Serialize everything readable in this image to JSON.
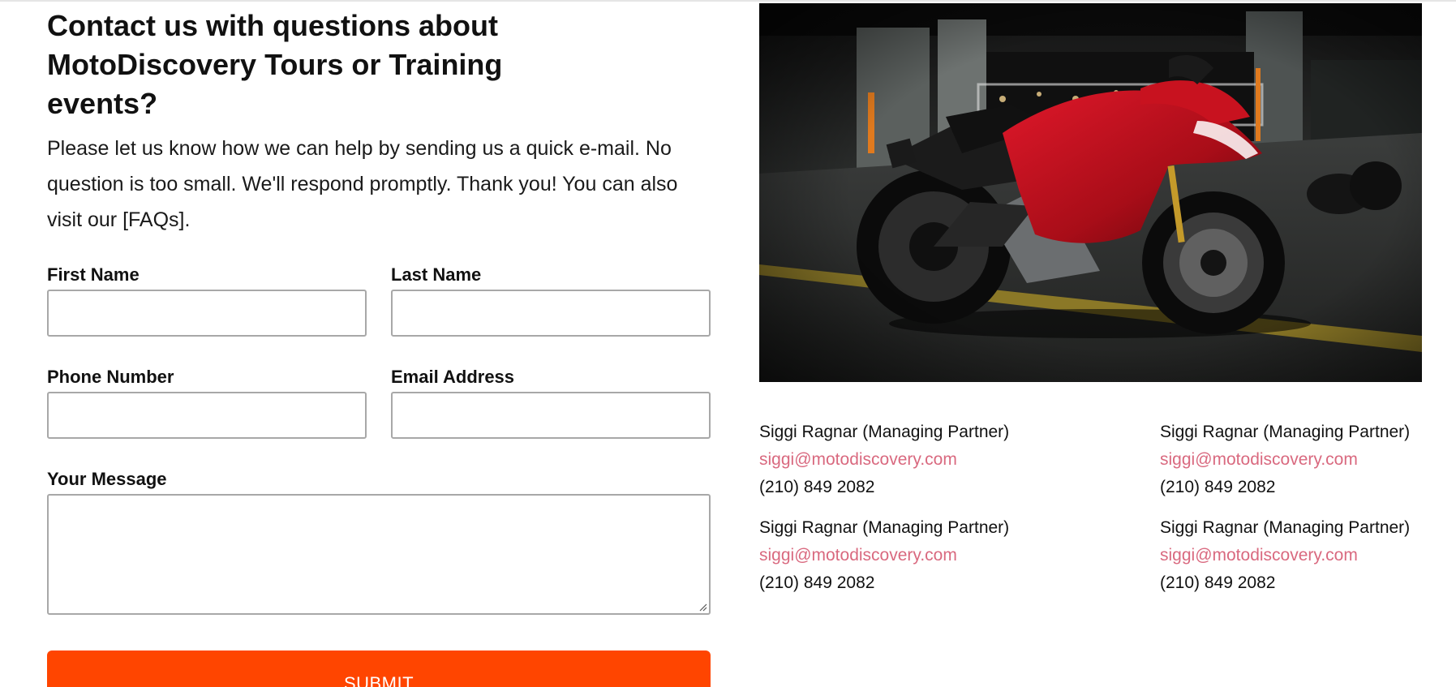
{
  "page": {
    "heading": "Contact us with questions about MotoDiscovery Tours or Training events?",
    "intro": "Please let us know how we can help by sending us a quick e-mail. No question is too small. We'll respond promptly. Thank you! You can also visit our [FAQs]."
  },
  "form": {
    "first_name_label": "First Name",
    "last_name_label": "Last Name",
    "phone_label": "Phone Number",
    "email_label": "Email Address",
    "message_label": "Your Message",
    "first_name_value": "",
    "last_name_value": "",
    "phone_value": "",
    "email_value": "",
    "message_value": "",
    "submit_label": "SUBMIT"
  },
  "hero": {
    "image_icon": "red-sport-motorcycle-in-parking-garage"
  },
  "contacts": [
    {
      "name": "Siggi Ragnar (Managing Partner)",
      "email": "siggi@motodiscovery.com",
      "phone": "(210) 849 2082"
    },
    {
      "name": "Siggi Ragnar (Managing Partner)",
      "email": "siggi@motodiscovery.com",
      "phone": "(210) 849 2082"
    },
    {
      "name": "Siggi Ragnar (Managing Partner)",
      "email": "siggi@motodiscovery.com",
      "phone": "(210) 849 2082"
    },
    {
      "name": "Siggi Ragnar (Managing Partner)",
      "email": "siggi@motodiscovery.com",
      "phone": "(210) 849 2082"
    }
  ],
  "colors": {
    "submit": "#ff4500",
    "link": "#d9697f",
    "text": "#111111",
    "input_border": "#a8a8a8"
  }
}
